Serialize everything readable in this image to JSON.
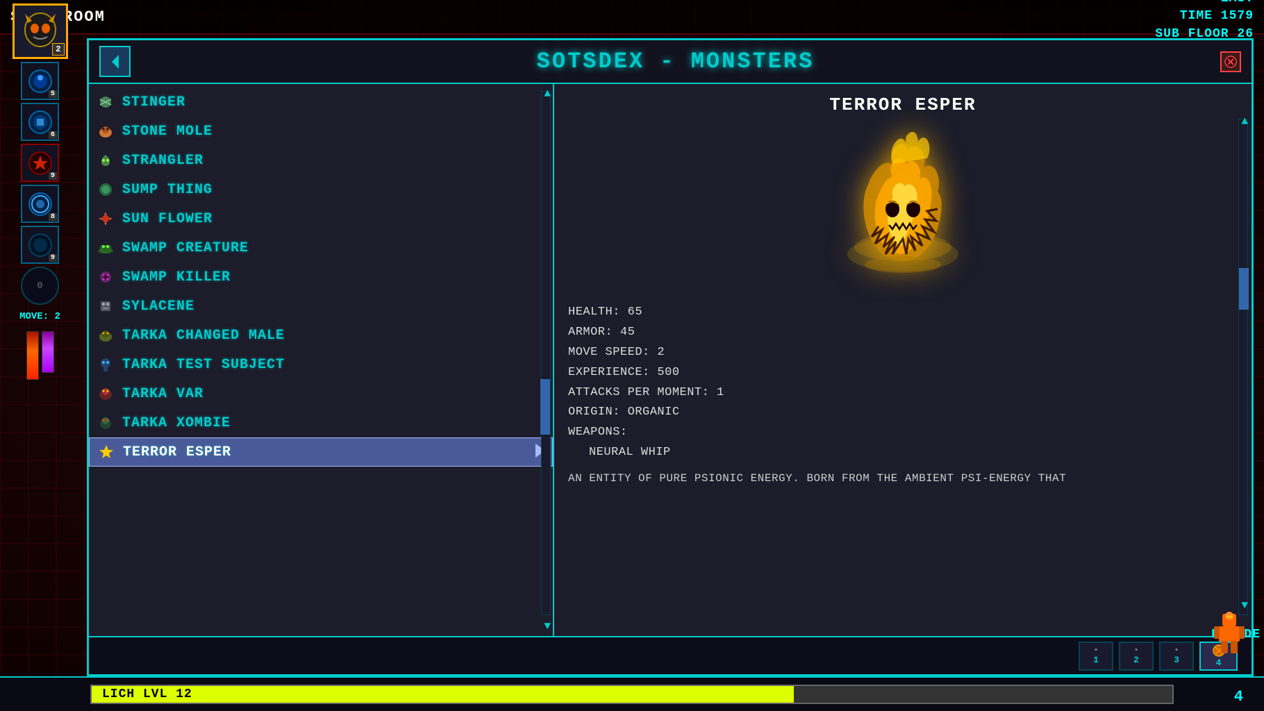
{
  "game": {
    "difficulty": "EASY",
    "time": "TIME 1579",
    "sub_floor": "SUB FLOOR 26",
    "storeroom_label": "STOREROOM",
    "move_label": "MOVE: 2",
    "renade_label": "RENADE",
    "bottom_num": "4"
  },
  "player": {
    "level": "LICH LVL 12",
    "avatar_badge": "2",
    "skills": [
      {
        "badge": "5",
        "icon": "🔵"
      },
      {
        "badge": "6",
        "icon": "🔵"
      },
      {
        "badge": "9",
        "icon": "💀"
      },
      {
        "badge": "8",
        "icon": "🔵"
      },
      {
        "badge": "9",
        "icon": "🔵"
      },
      {
        "badge": "0",
        "icon": "⭕"
      }
    ]
  },
  "panel": {
    "title": "SOTSDEX - MONSTERS",
    "back_icon": "▶",
    "close_icon": "✕"
  },
  "monster_list": {
    "items": [
      {
        "name": "STINGER",
        "icon": "🦟",
        "iconClass": "icon-bug",
        "selected": false
      },
      {
        "name": "STONE MOLE",
        "icon": "🦔",
        "iconClass": "icon-mole",
        "selected": false
      },
      {
        "name": "STRANGLER",
        "icon": "🌿",
        "iconClass": "icon-plant",
        "selected": false
      },
      {
        "name": "SUMP THING",
        "icon": "💚",
        "iconClass": "icon-sump",
        "selected": false
      },
      {
        "name": "SUN FLOWER",
        "icon": "🌺",
        "iconClass": "icon-flower",
        "selected": false
      },
      {
        "name": "SWAMP CREATURE",
        "icon": "🦎",
        "iconClass": "icon-swamp",
        "selected": false
      },
      {
        "name": "SWAMP KILLER",
        "icon": "🦂",
        "iconClass": "icon-killer",
        "selected": false
      },
      {
        "name": "SYLACENE",
        "icon": "👾",
        "iconClass": "icon-syla",
        "selected": false
      },
      {
        "name": "TARKA CHANGED MALE",
        "icon": "🐊",
        "iconClass": "icon-tarka",
        "selected": false
      },
      {
        "name": "TARKA TEST SUBJECT",
        "icon": "🔬",
        "iconClass": "icon-tarka2",
        "selected": false
      },
      {
        "name": "TARKA VAR",
        "icon": "🐉",
        "iconClass": "icon-tarka3",
        "selected": false
      },
      {
        "name": "TARKA XOMBIE",
        "icon": "🧟",
        "iconClass": "icon-xombie",
        "selected": false
      },
      {
        "name": "TERROR ESPER",
        "icon": "⚡",
        "iconClass": "icon-esper",
        "selected": true
      }
    ]
  },
  "selected_monster": {
    "name": "TERROR ESPER",
    "stats": {
      "health": "HEALTH: 65",
      "armor": "ARMOR: 45",
      "move_speed": "MOVE SPEED: 2",
      "experience": "EXPERIENCE: 500",
      "attacks": "ATTACKS PER MOMENT: 1",
      "origin": "ORIGIN: ORGANIC",
      "weapons_label": "WEAPONS:",
      "weapon1": "NEURAL WHIP"
    },
    "description": "AN ENTITY OF PURE PSIONIC ENERGY. BORN FROM THE AMBIENT PSI-ENERGY THAT"
  },
  "action_slots": {
    "slots": [
      {
        "label": "1",
        "active": false
      },
      {
        "label": "2",
        "active": false
      },
      {
        "label": "3",
        "active": false
      },
      {
        "label": "4",
        "active": true
      }
    ]
  }
}
